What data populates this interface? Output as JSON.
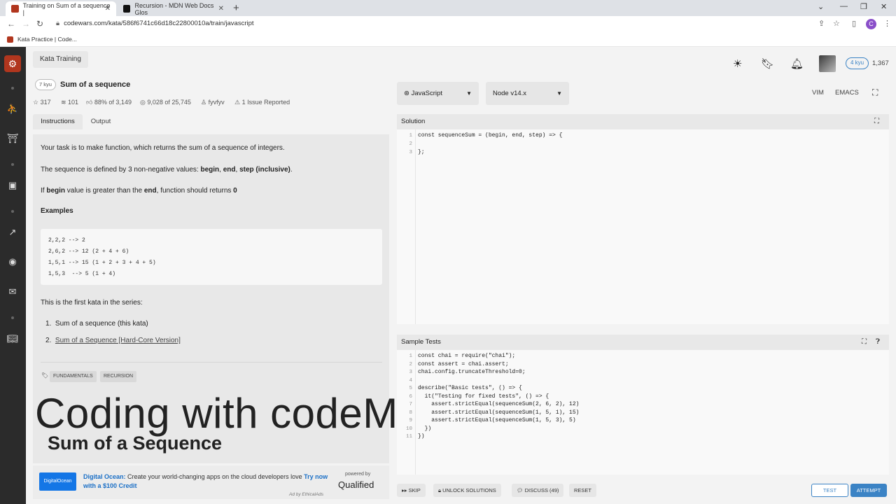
{
  "browser": {
    "tabs": [
      {
        "title": "Training on Sum of a sequence |",
        "active": true
      },
      {
        "title": "Recursion - MDN Web Docs Glos",
        "active": false
      }
    ],
    "url": "codewars.com/kata/586f6741c66d18c22800010a/train/javascript",
    "bookmark": "Kata Practice | Code...",
    "profile_initial": "C"
  },
  "header": {
    "section": "Kata Training",
    "rank_badge": "4 kyu",
    "honor": "1,367"
  },
  "kata": {
    "kyu": "7 kyu",
    "title": "Sum of a sequence",
    "stats": {
      "stars": "317",
      "collections": "101",
      "satisfaction": "88% of 3,149",
      "completed": "9,028 of 25,745",
      "author": "fyvfyv",
      "issues": "1 Issue Reported"
    }
  },
  "tabs": {
    "instructions": "Instructions",
    "output": "Output"
  },
  "description": {
    "p1": "Your task is to make function, which returns the sum of a sequence of integers.",
    "p2_pre": "The sequence is defined by 3 non-negative values: ",
    "p2_begin": "begin",
    "p2_c1": ", ",
    "p2_end": "end",
    "p2_c2": ", ",
    "p2_step": "step (inclusive)",
    "p2_post": ".",
    "p3_pre": "If ",
    "p3_begin": "begin",
    "p3_mid": " value is greater than the ",
    "p3_end": "end",
    "p3_post": ", function should returns ",
    "p3_zero": "0",
    "examples_heading": "Examples",
    "examples": [
      "2,2,2 --> 2",
      "2,6,2 --> 12 (2 + 4 + 6)",
      "1,5,1 --> 15 (1 + 2 + 3 + 4 + 5)",
      "1,5,3  --> 5 (1 + 4)"
    ],
    "series_intro": "This is the first kata in the series:",
    "series": [
      {
        "num": "1.",
        "text": "Sum of a sequence (this kata)"
      },
      {
        "num": "2.",
        "text": "Sum of a Sequence [Hard-Core Version]"
      }
    ],
    "tags": [
      "FUNDAMENTALS",
      "RECURSION"
    ]
  },
  "overlay": {
    "title": "Coding with codeManS",
    "subtitle": "Sum of a Sequence"
  },
  "ad": {
    "logo": "DigitalOcean",
    "brand": "Digital Ocean:",
    "text": " Create your world-changing apps on the cloud developers love ",
    "cta": "Try now with a $100 Credit",
    "powered_by": "powered by",
    "qualified": "Qualified",
    "ethical": "Ad by EthicalAds"
  },
  "editor": {
    "language": "JavaScript",
    "runtime": "Node v14.x",
    "vim": "VIM",
    "emacs": "EMACS",
    "solution_label": "Solution",
    "solution_lines": [
      {
        "n": "1",
        "code": "const sequenceSum = (begin, end, step) => {"
      },
      {
        "n": "2",
        "code": ""
      },
      {
        "n": "3",
        "code": "};"
      }
    ],
    "tests_label": "Sample Tests",
    "test_lines": [
      {
        "n": "1",
        "code": "const chai = require(\"chai\");"
      },
      {
        "n": "2",
        "code": "const assert = chai.assert;"
      },
      {
        "n": "3",
        "code": "chai.config.truncateThreshold=0;"
      },
      {
        "n": "4",
        "code": ""
      },
      {
        "n": "5",
        "code": "describe(\"Basic tests\", () => {"
      },
      {
        "n": "6",
        "code": "  it(\"Testing for fixed tests\", () => {"
      },
      {
        "n": "7",
        "code": "    assert.strictEqual(sequenceSum(2, 6, 2), 12)"
      },
      {
        "n": "8",
        "code": "    assert.strictEqual(sequenceSum(1, 5, 1), 15)"
      },
      {
        "n": "9",
        "code": "    assert.strictEqual(sequenceSum(1, 5, 3), 5)"
      },
      {
        "n": "10",
        "code": "  })"
      },
      {
        "n": "11",
        "code": "})"
      }
    ]
  },
  "actions": {
    "skip": "SKIP",
    "unlock": "UNLOCK SOLUTIONS",
    "discuss": "DISCUSS (49)",
    "reset": "RESET",
    "test": "TEST",
    "attempt": "ATTEMPT"
  },
  "colors": {
    "accent": "#3b83c5",
    "brand": "#b1361e",
    "sidebar": "#2b2b2b"
  }
}
